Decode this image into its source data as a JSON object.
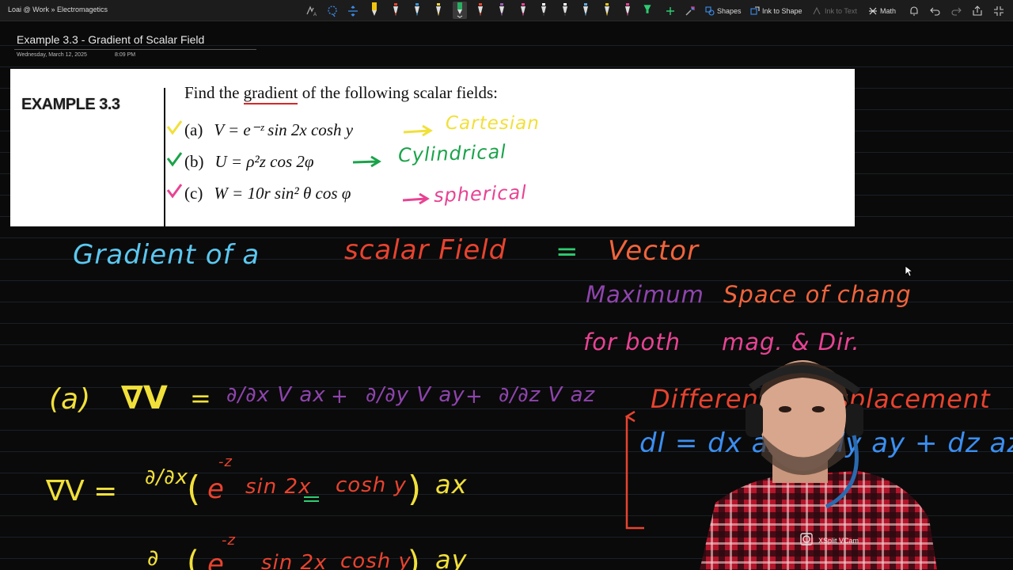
{
  "app": {
    "breadcrumb": "Loai @ Work » Electromagetics"
  },
  "toolbar": {
    "shapes_label": "Shapes",
    "ink_to_shape_label": "Ink to Shape",
    "ink_to_text_label": "Ink to Text",
    "math_label": "Math",
    "pen_colors": [
      "#f1c40f",
      "#e8432f",
      "#3498db",
      "#f4d03f",
      "#27ae60",
      "#e84393",
      "#9b59b6",
      "#e84393",
      "#ffffff",
      "#ffffff",
      "#5dade2",
      "#f1c40f",
      "#e84393",
      "#2ecc71"
    ]
  },
  "page": {
    "title": "Example 3.3 - Gradient of Scalar Field",
    "date": "Wednesday, March 12, 2025",
    "time": "8:09 PM"
  },
  "example": {
    "label": "EXAMPLE 3.3",
    "prompt_before": "Find the ",
    "prompt_underlined": "gradient",
    "prompt_after": " of the following scalar fields:",
    "items": [
      {
        "tag": "(a)",
        "equation": "V = e⁻ᶻ sin 2x cosh y"
      },
      {
        "tag": "(b)",
        "equation": "U = ρ²z cos 2φ"
      },
      {
        "tag": "(c)",
        "equation": "W = 10r sin² θ cos φ"
      }
    ]
  },
  "ink": {
    "cartesian": "Cartesian",
    "cylindrical": "Cylindrical",
    "spherical": "spherical",
    "gradient_w1": "Gradient of a",
    "gradient_w2": "scalar Field",
    "equals": "=",
    "vector": "Vector",
    "maximum": "Maximum",
    "space_of_change": "Space of chang",
    "for_both": "for both",
    "mag_dir": "mag. & Dir.",
    "part_a": "(a)",
    "nabla_v": "∇V",
    "eq_sign": "=",
    "term_x": "∂/∂x V ax",
    "plus": "+",
    "term_y": "∂/∂y V ay",
    "term_z": "∂/∂z V az",
    "differential_label": "Differential displacement",
    "dl_eq": "dl = dx ax + dy ay + dz az",
    "line2_lhs": "∇V =",
    "line2_dx": "∂/∂x",
    "line2_e": "e",
    "line2_exp": "-z",
    "line2_sin": "sin 2x",
    "line2_cosh": "cosh y",
    "line2_ax": "ax",
    "line3_dy": "∂",
    "line3_ay": "ay"
  },
  "webcam": {
    "label": "XSplit VCam"
  }
}
